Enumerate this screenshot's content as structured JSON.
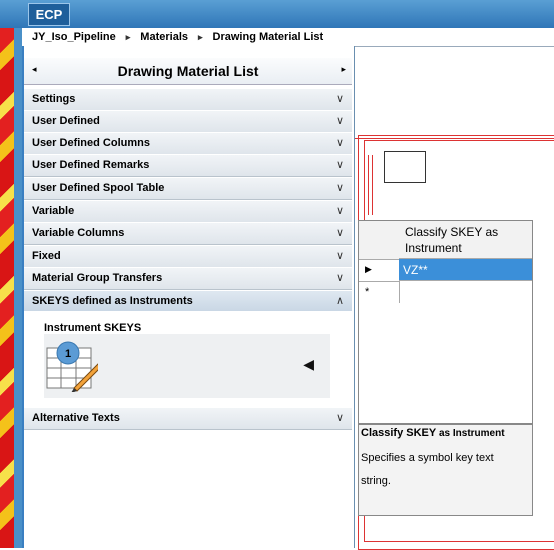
{
  "app": {
    "logo": "ECP"
  },
  "breadcrumb": {
    "items": [
      "JY_Iso_Pipeline",
      "Materials",
      "Drawing Material List"
    ],
    "sep": "▸"
  },
  "panel": {
    "title": "Drawing Material List",
    "left_arrow": "◂",
    "right_arrow": "▸",
    "sections": [
      "Settings",
      "User Defined",
      "User Defined Columns",
      "User Defined Remarks",
      "User Defined Spool Table",
      "Variable",
      "Variable Columns",
      "Fixed",
      "Material Group Transfers",
      "SKEYS defined as Instruments",
      "Alternative Texts"
    ],
    "collapsed_glyph": "∨",
    "expanded_glyph": "∧",
    "expanded_section": {
      "label": "Instrument SKEYS",
      "badge": "1",
      "arrow": "◀"
    }
  },
  "table": {
    "column_header": "Classify SKEY as Instrument",
    "rows": [
      {
        "indicator": "▶",
        "value": "VZ**"
      },
      {
        "indicator": "*",
        "value": ""
      }
    ]
  },
  "description": {
    "title_bold": "Classify SKEY",
    "title_rest": " as Instrument",
    "text": "Specifies a symbol key text string."
  },
  "colors": {
    "titlebar": "#3b86c8",
    "selection": "#3b8fd9",
    "drawing_lines": "#dd3333"
  },
  "icons": [
    "grid-pencil-icon",
    "triangle-left-icon",
    "chevron-down-icon",
    "chevron-up-icon"
  ]
}
